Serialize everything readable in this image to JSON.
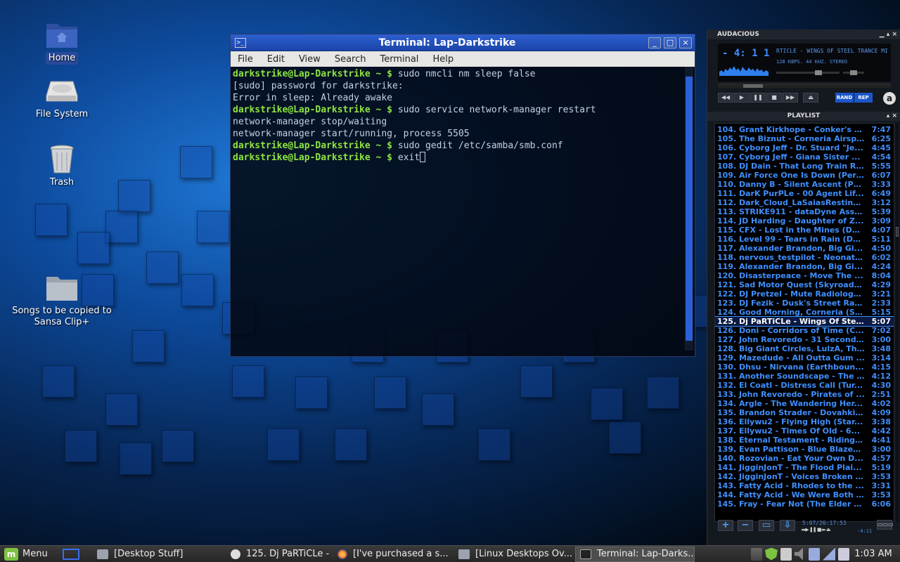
{
  "colors": {
    "terminal_prompt": "#8ee53f",
    "terminal_text": "#c4d0e4",
    "window_title_bar": "#1b45a8",
    "playlist_text": "#3f8fff",
    "taskbar": "#262626",
    "mint_green": "#7cc243"
  },
  "desktop": {
    "icons": [
      {
        "label": "Home",
        "icon": "home-folder-icon"
      },
      {
        "label": "File System",
        "icon": "hard-drive-icon"
      },
      {
        "label": "Trash",
        "icon": "trash-icon"
      },
      {
        "label": "Songs to be copied to Sansa Clip+",
        "icon": "folder-icon"
      }
    ]
  },
  "terminal": {
    "title": "Terminal: Lap-Darkstrike",
    "window_buttons": {
      "minimize": "_",
      "maximize": "□",
      "close": "×"
    },
    "menu": [
      "File",
      "Edit",
      "View",
      "Search",
      "Terminal",
      "Help"
    ],
    "prompt": "darkstrike@Lap-Darkstrike ~ $",
    "lines": [
      {
        "type": "cmd",
        "text": "sudo nmcli nm sleep false"
      },
      {
        "type": "out",
        "text": "[sudo] password for darkstrike:"
      },
      {
        "type": "out",
        "text": "Error in sleep: Already awake"
      },
      {
        "type": "cmd",
        "text": "sudo service network-manager restart"
      },
      {
        "type": "out",
        "text": "network-manager stop/waiting"
      },
      {
        "type": "out",
        "text": "network-manager start/running, process 5505"
      },
      {
        "type": "cmd",
        "text": "sudo gedit /etc/samba/smb.conf"
      },
      {
        "type": "cmd",
        "text": "exit"
      }
    ]
  },
  "audacious": {
    "title": "AUDACIOUS",
    "time": "- 4: 1 1",
    "marquee": "RTICLE - WINGS OF STEEL TRANCE MI",
    "info": "128 KBPS. 44 KHZ. STEREO",
    "shuffle_label": "RAND",
    "repeat_label": "REP",
    "logo": "a"
  },
  "playlist": {
    "title": "PLAYLIST",
    "current_index": 21,
    "items": [
      {
        "title": "104. Grant Kirkhope - Conker's B...",
        "time": "7:47"
      },
      {
        "title": "105. The Biznut - Corneria Airsp...",
        "time": "6:25"
      },
      {
        "title": "106. Cyborg Jeff - Dr. Stuard \"Je...",
        "time": "4:45"
      },
      {
        "title": "107. Cyborg Jeff - Giana Sister ...",
        "time": "4:54"
      },
      {
        "title": "108. DJ Dain - That Long Train R...",
        "time": "5:55"
      },
      {
        "title": "109. Air Force One Is Down (Perf...",
        "time": "6:07"
      },
      {
        "title": "110. Danny B - Silent Ascent (Pe...",
        "time": "3:33"
      },
      {
        "title": "111. DarK PurPLe - 00 Agent Lif...",
        "time": "6:49"
      },
      {
        "title": "112. Dark_Cloud_LaSaiasResting...",
        "time": "3:12"
      },
      {
        "title": "113. STRIKE911 - dataDyne Assa...",
        "time": "5:39"
      },
      {
        "title": "114. JD Harding - Daughter of Z...",
        "time": "3:09"
      },
      {
        "title": "115. CFX - Lost in the Mines (De...",
        "time": "4:07"
      },
      {
        "title": "116. Level 99 - Tears in Rain (De...",
        "time": "5:11"
      },
      {
        "title": "117. Alexander Brandon, Big Gi...",
        "time": "4:50"
      },
      {
        "title": "118. nervous_testpilot - Neonatu...",
        "time": "6:02"
      },
      {
        "title": "119. Alexander Brandon, Big Gi...",
        "time": "4:24"
      },
      {
        "title": "120. Disasterpeace - Move The ...",
        "time": "8:04"
      },
      {
        "title": "121. Sad Motor Quest (Skyroads...",
        "time": "4:29"
      },
      {
        "title": "122. DJ Pretzel - Mute Radiology...",
        "time": "3:21"
      },
      {
        "title": "123. DJ Fezik - Dusk's Street Rac...",
        "time": "2:33"
      },
      {
        "title": "124. Good Morning, Corneria (St...",
        "time": "5:15"
      },
      {
        "title": "125. Dj PaRTiCLe - Wings Of Ste...",
        "time": "5:07"
      },
      {
        "title": "126. Doni - Corridors of Time (C...",
        "time": "7:02"
      },
      {
        "title": "127. John Revoredo - 31 Seconds...",
        "time": "3:00"
      },
      {
        "title": "128. Big Giant Circles, LulzA, Th...",
        "time": "3:48"
      },
      {
        "title": "129. Mazedude - All Outta Gum ...",
        "time": "3:14"
      },
      {
        "title": "130. Dhsu - Nirvana (Earthboun...",
        "time": "4:15"
      },
      {
        "title": "131. Another Soundscape - The ...",
        "time": "4:12"
      },
      {
        "title": "132. El Coatl - Distress Call (Tur...",
        "time": "4:30"
      },
      {
        "title": "133. John Revoredo - Pirates of ...",
        "time": "2:51"
      },
      {
        "title": "134. Argle - The Wandering Her...",
        "time": "4:02"
      },
      {
        "title": "135. Brandon Strader - Dovahkii...",
        "time": "4:09"
      },
      {
        "title": "136. Ellywu2 - Flying High (Star...",
        "time": "3:38"
      },
      {
        "title": "137. Ellywu2 - Times Of Old - 6...",
        "time": "4:42"
      },
      {
        "title": "138. Eternal Testament - Riding ...",
        "time": "4:41"
      },
      {
        "title": "139. Evan Pattison - Blue Blazes...",
        "time": "3:00"
      },
      {
        "title": "140. Rozovian - Eat Your Own D...",
        "time": "4:57"
      },
      {
        "title": "141. JigginJonT - The Flood Plai...",
        "time": "5:19"
      },
      {
        "title": "142. JigginJonT - Voices Broken (...",
        "time": "3:53"
      },
      {
        "title": "143. Fatty Acid - Rhodes to the ...",
        "time": "3:31"
      },
      {
        "title": "144. Fatty Acid - We Were Both ...",
        "time": "3:53"
      },
      {
        "title": "145. Fray - Fear Not (The Elder S...",
        "time": "6:06"
      }
    ],
    "footer": {
      "add": "+",
      "remove": "−",
      "select": "▭",
      "misc": "⇩",
      "time": "5:07/26:17:53",
      "remaining": "-4:11",
      "options": "▭▭▭"
    }
  },
  "taskbar": {
    "menu_label": "Menu",
    "mint_logo": "m",
    "tasks": [
      {
        "label": "[Desktop Stuff]",
        "icon": "folder-icon"
      },
      {
        "label": "125. Dj PaRTiCLe - ...",
        "icon": "audacious-icon"
      },
      {
        "label": "[I've purchased a s...",
        "icon": "firefox-icon"
      },
      {
        "label": "[Linux Desktops Ov...",
        "icon": "folder-icon"
      },
      {
        "label": "Terminal: Lap-Darks...",
        "icon": "terminal-icon"
      }
    ],
    "clock": "1:03 AM"
  }
}
